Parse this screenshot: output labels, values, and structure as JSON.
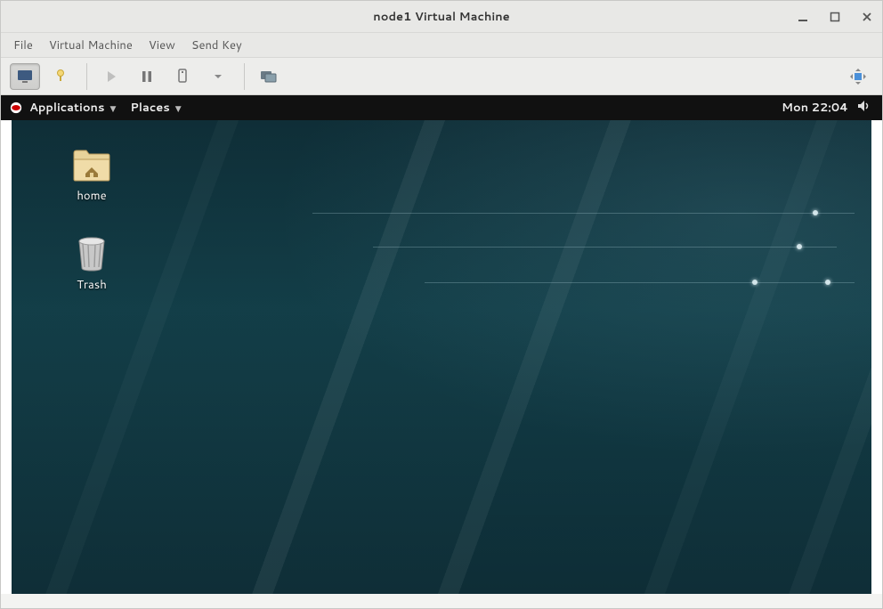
{
  "window": {
    "title": "node1 Virtual Machine"
  },
  "menubar": {
    "file": "File",
    "virtual_machine": "Virtual Machine",
    "view": "View",
    "send_key": "Send Key"
  },
  "guest": {
    "panel": {
      "applications_label": "Applications",
      "places_label": "Places",
      "clock": "Mon 22:04"
    },
    "icons": {
      "home": "home",
      "trash": "Trash"
    }
  }
}
